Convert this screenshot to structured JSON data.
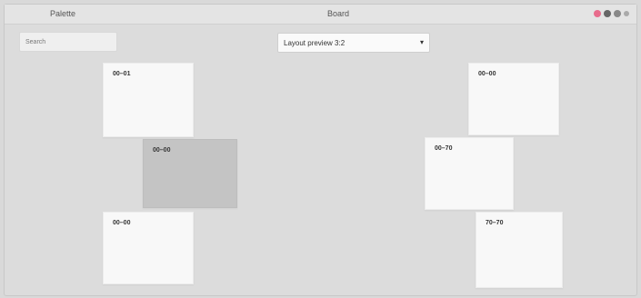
{
  "titlebar": {
    "left_label": "Palette",
    "title": "Board"
  },
  "toolbar": {
    "field_text": "Search",
    "select_value": "Layout preview 3:2",
    "select_chevron": "▾"
  },
  "cards": [
    {
      "label": "00–01",
      "selected": false
    },
    {
      "label": "00–00",
      "selected": true
    },
    {
      "label": "00–00",
      "selected": false
    },
    {
      "label": "00–00",
      "selected": false
    },
    {
      "label": "00–70",
      "selected": false
    },
    {
      "label": "70–70",
      "selected": false
    }
  ]
}
